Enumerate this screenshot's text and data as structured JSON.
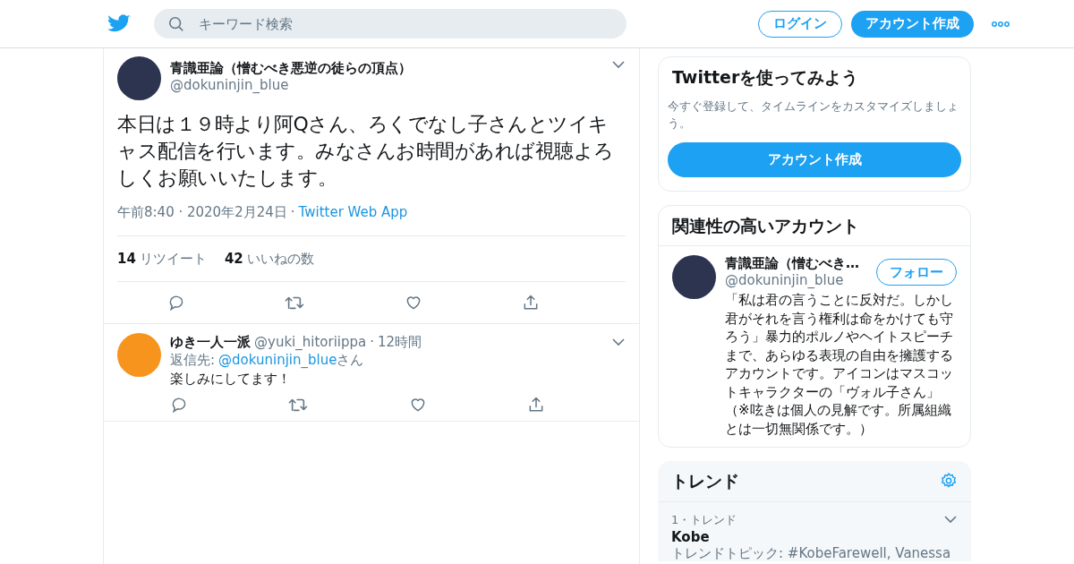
{
  "header": {
    "search": {
      "placeholder": "キーワード検索"
    },
    "login": "ログイン",
    "signup": "アカウント作成"
  },
  "tweet": {
    "name": "青識亜論（憎むべき悪逆の徒らの頂点）",
    "handle": "@dokuninjin_blue",
    "text": "本日は１９時より阿Qさん、ろくでなし子さんとツイキャス配信を行います。みなさんお時間があれば視聴よろしくお願いいたします。",
    "time": "午前8:40 · 2020年2月24日",
    "separator": "·",
    "source": "Twitter Web App",
    "stats": [
      {
        "count": "14",
        "label": "リツイート"
      },
      {
        "count": "42",
        "label": "いいねの数"
      }
    ]
  },
  "replies": [
    {
      "name": "ゆき一人一派",
      "handle": "@yuki_hitoriippa",
      "separator": "·",
      "time": "12時間",
      "reply_prefix": "返信先:",
      "reply_to": "@dokuninjin_blue",
      "reply_suffix": "さん",
      "text": "楽しみにしてます！"
    }
  ],
  "signup_card": {
    "title": "Twitterを使ってみよう",
    "text": "今すぐ登録して、タイムラインをカスタマイズしましょう。",
    "button": "アカウント作成"
  },
  "related": {
    "title": "関連性の高いアカウント",
    "accounts": [
      {
        "name": "青識亜論（憎むべき…",
        "handle": "@dokuninjin_blue",
        "follow": "フォロー",
        "bio": "「私は君の言うことに反対だ。しかし君がそれを言う権利は命をかけても守ろう」暴力的ポルノやヘイトスピーチまで、あらゆる表現の自由を擁護するアカウントです。アイコンはマスコットキャラクターの「ヴォル子さん」（※呟きは個人の見解です。所属組織とは一切無関係です。）"
      }
    ]
  },
  "trends": {
    "title": "トレンド",
    "items": [
      {
        "meta": "1・トレンド",
        "name": "Kobe",
        "topic": "トレンドトピック: #KobeFarewell, Vanessa"
      }
    ]
  }
}
